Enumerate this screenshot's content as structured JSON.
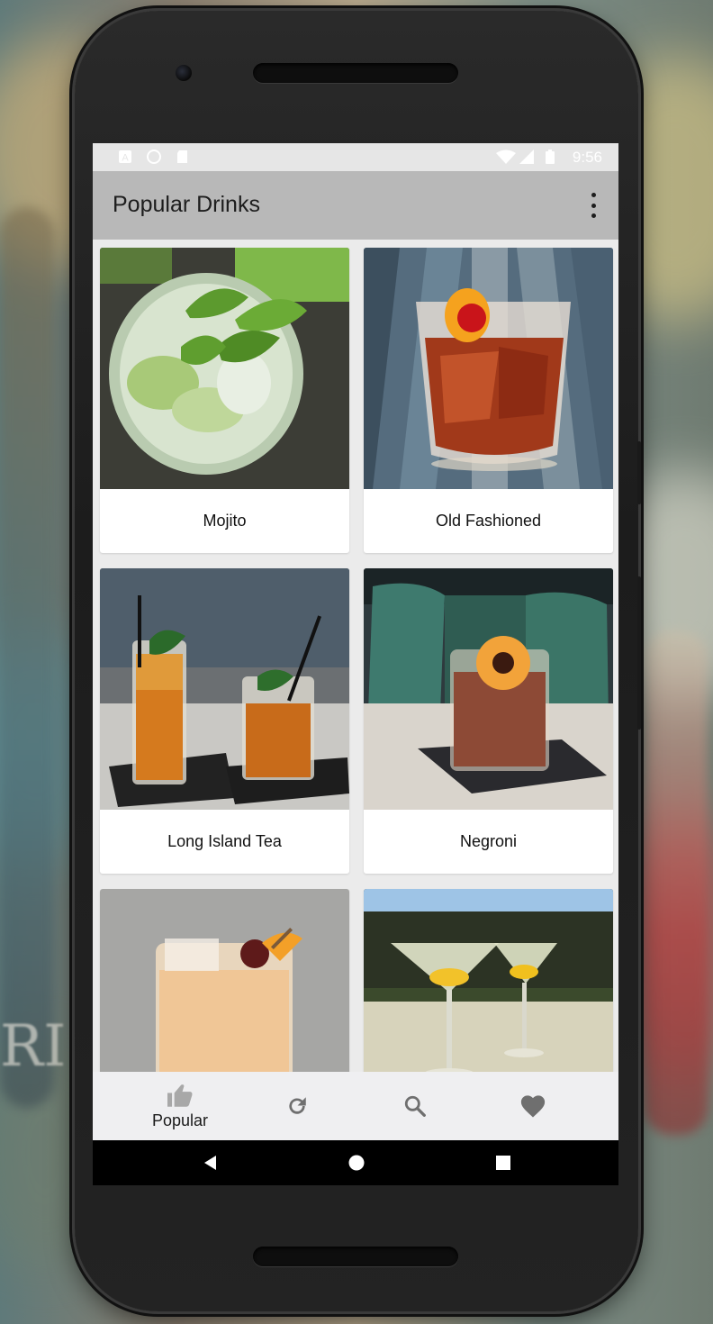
{
  "app": {
    "title": "Popular Drinks",
    "accent_color": "#b8b8b8"
  },
  "status_bar": {
    "time": "9:56",
    "left_icons": [
      "a-notification-icon",
      "circle-notification-icon",
      "sd-card-icon"
    ],
    "right_icons": [
      "wifi-icon",
      "signal-icon",
      "battery-icon"
    ]
  },
  "toolbar": {
    "menu_icon": "more-vert-icon"
  },
  "drinks": [
    {
      "name": "Mojito"
    },
    {
      "name": "Old Fashioned"
    },
    {
      "name": "Long Island Tea"
    },
    {
      "name": "Negroni"
    },
    {
      "name": ""
    },
    {
      "name": ""
    }
  ],
  "bottom_nav": {
    "items": [
      {
        "icon": "thumb-up-icon",
        "label": "Popular",
        "selected": true
      },
      {
        "icon": "refresh-icon",
        "label": "",
        "selected": false
      },
      {
        "icon": "search-icon",
        "label": "",
        "selected": false
      },
      {
        "icon": "heart-icon",
        "label": "",
        "selected": false
      }
    ]
  },
  "system_nav": {
    "icons": [
      "back-icon",
      "home-icon",
      "recents-icon"
    ]
  }
}
